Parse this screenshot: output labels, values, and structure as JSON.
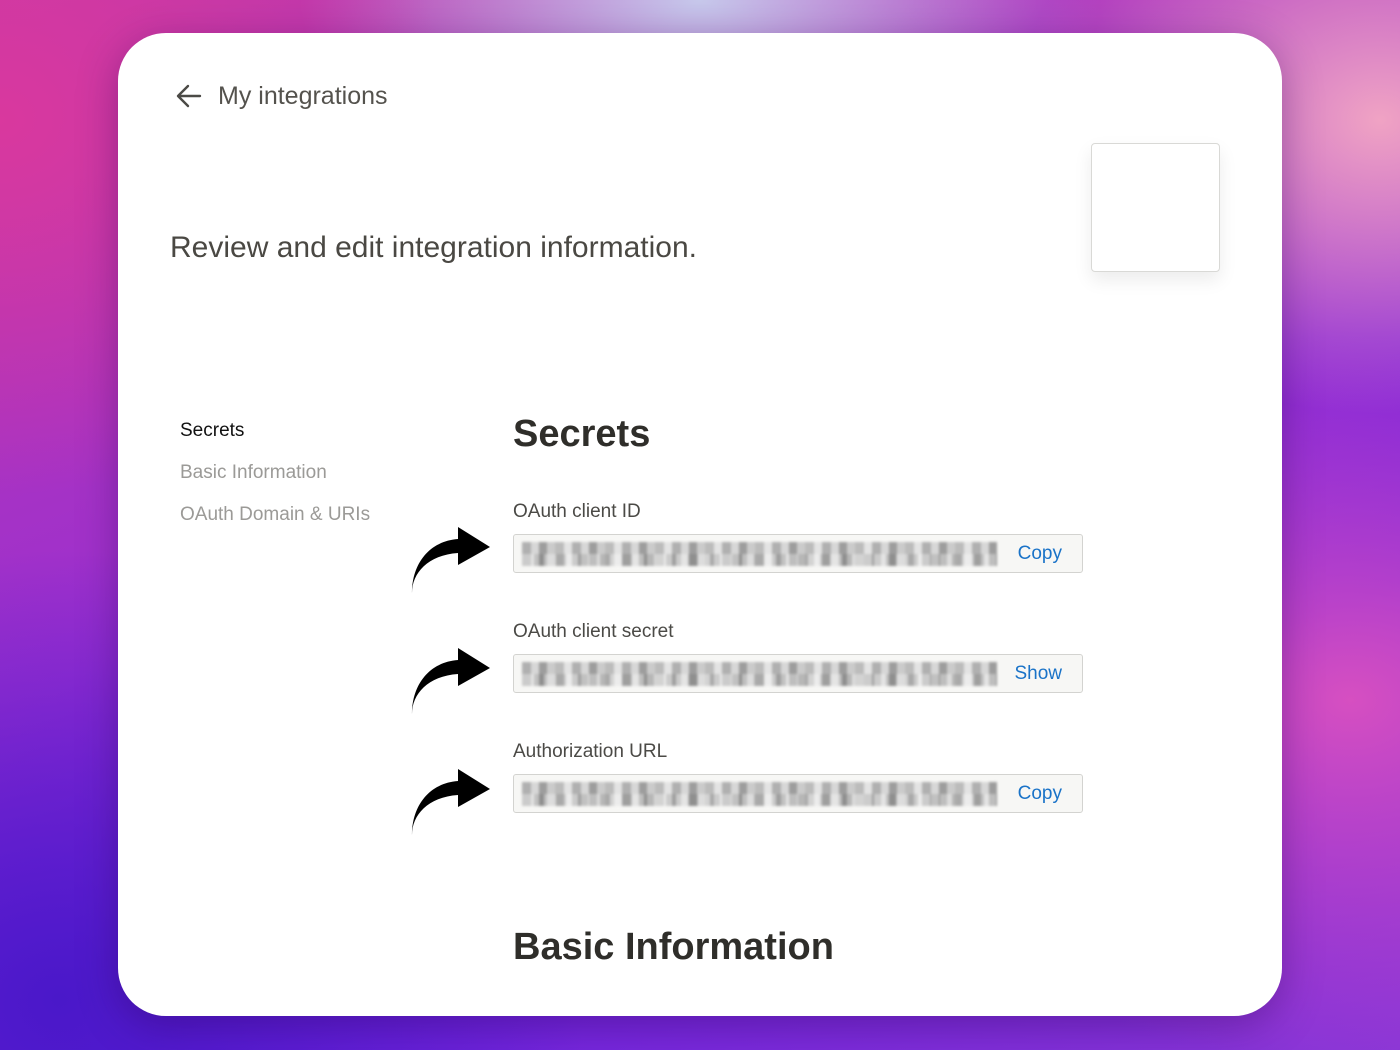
{
  "header": {
    "back_label": "My integrations"
  },
  "subtitle": "Review and edit integration information.",
  "sidenav": {
    "items": [
      {
        "label": "Secrets",
        "active": true
      },
      {
        "label": "Basic Information",
        "active": false
      },
      {
        "label": "OAuth Domain & URIs",
        "active": false
      }
    ]
  },
  "secrets": {
    "title": "Secrets",
    "fields": [
      {
        "label": "OAuth client ID",
        "action": "Copy"
      },
      {
        "label": "OAuth client secret",
        "action": "Show"
      },
      {
        "label": "Authorization URL",
        "action": "Copy"
      }
    ]
  },
  "basic_information": {
    "title": "Basic Information"
  },
  "icons": {
    "back": "arrow-left-icon",
    "pointer": "curved-arrow-right-icon"
  },
  "colors": {
    "link": "#1a73c8",
    "text": "#37352f",
    "muted": "#9b9a97"
  }
}
